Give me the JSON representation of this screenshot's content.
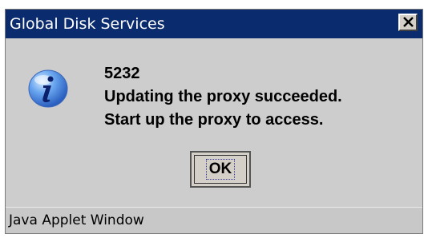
{
  "window": {
    "title": "Global Disk Services",
    "close_icon": "close-icon",
    "title_bar_color": "#0a2b6d"
  },
  "dialog": {
    "icon": "info-icon",
    "code": "5232",
    "line1": "Updating the proxy succeeded.",
    "line2": "Start up the proxy to access.",
    "ok_label": "OK"
  },
  "statusbar": {
    "text": "Java Applet Window"
  }
}
